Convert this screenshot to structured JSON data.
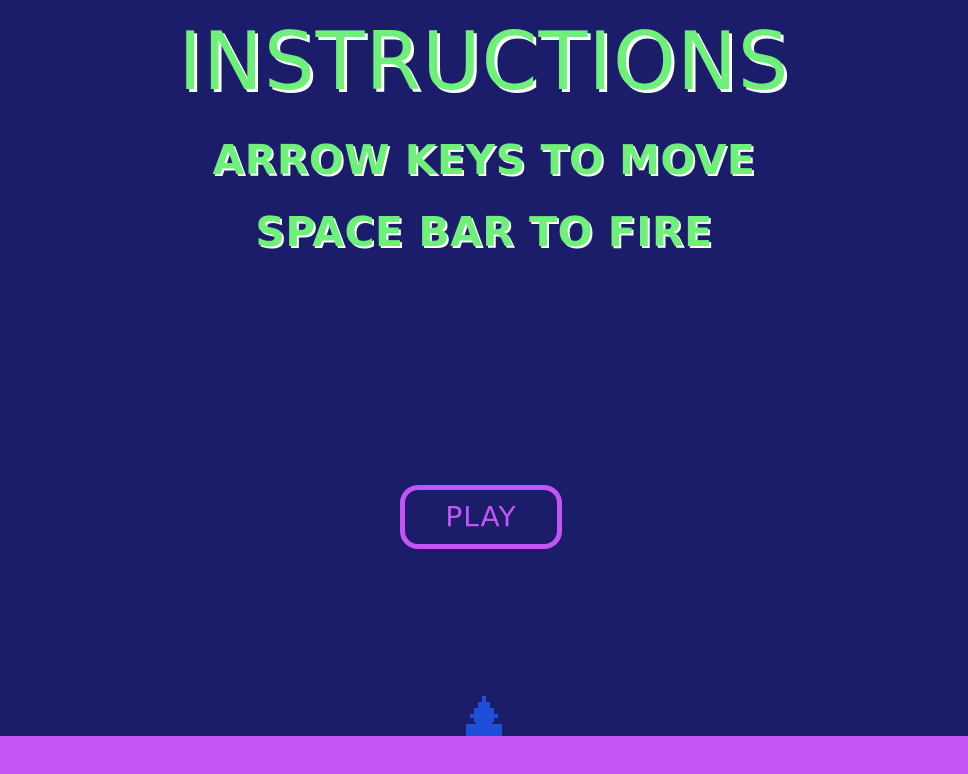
{
  "screen": {
    "title": "INSTRUCTIONS",
    "instructions": [
      "ARROW KEYS TO MOVE",
      "SPACE BAR TO FIRE"
    ],
    "play_label": "PLAY"
  },
  "player": {
    "icon": "player-ship-icon"
  },
  "colors": {
    "background": "#1b1c6a",
    "text": "#6ef07a",
    "text_shadow": "#ffffff",
    "accent": "#c455f5",
    "ship": "#1d4fd8"
  }
}
